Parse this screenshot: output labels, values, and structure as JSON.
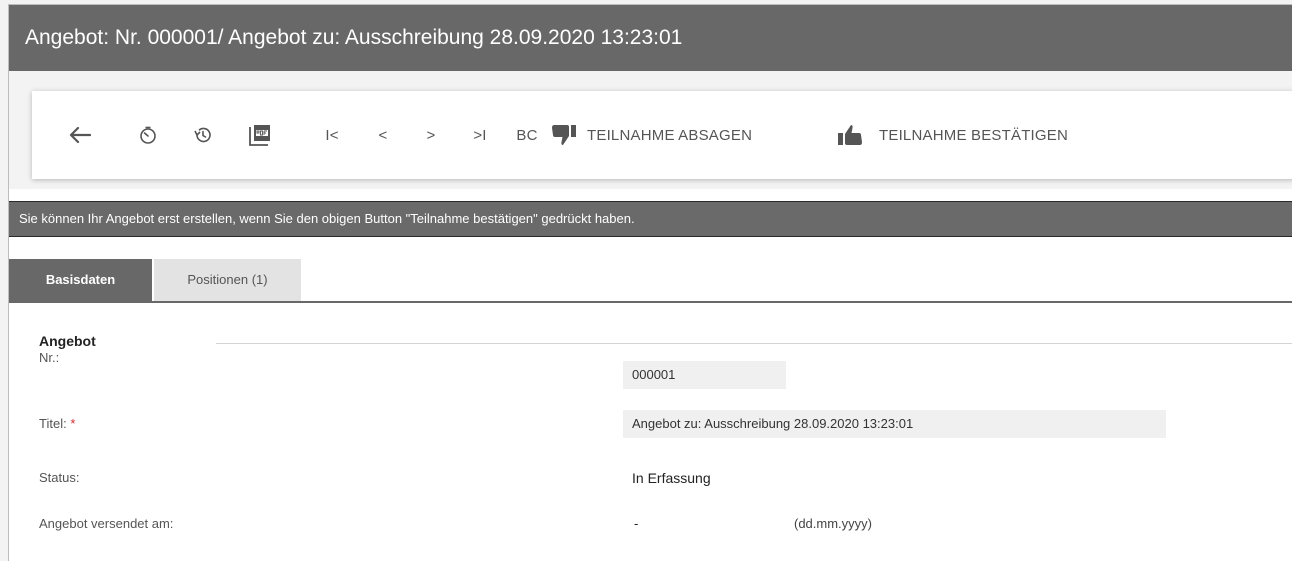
{
  "window": {
    "title": "Angebot: Nr. 000001/ Angebot zu: Ausschreibung 28.09.2020 13:23:01"
  },
  "toolbar": {
    "back_icon": "arrow-left-icon",
    "timer_icon": "stopwatch-icon",
    "history_icon": "history-icon",
    "pdf_icon": "pdf-icon",
    "first_label": "I<",
    "prev_label": "<",
    "next_label": ">",
    "last_label": ">I",
    "bc_label": "BC",
    "decline_label": "TEILNAHME ABSAGEN",
    "decline_icon": "thumbs-down-icon",
    "confirm_label": "TEILNAHME BESTÄTIGEN",
    "confirm_icon": "thumbs-up-icon"
  },
  "notice": {
    "text": "Sie können Ihr Angebot erst erstellen, wenn Sie den obigen Button \"Teilnahme bestätigen\" gedrückt haben."
  },
  "tabs": [
    {
      "label": "Basisdaten",
      "active": true
    },
    {
      "label": "Positionen (1)",
      "active": false
    }
  ],
  "form": {
    "section_title": "Angebot",
    "fields": {
      "nr": {
        "label": "Nr.:",
        "value": "000001"
      },
      "titel": {
        "label": "Titel:",
        "required_mark": "*",
        "value": "Angebot zu: Ausschreibung 28.09.2020 13:23:01"
      },
      "status": {
        "label": "Status:",
        "value": "In Erfassung"
      },
      "versendet": {
        "label": "Angebot versendet am:",
        "value": "-",
        "format_hint": "(dd.mm.yyyy)"
      }
    }
  },
  "colors": {
    "header_bg": "#676867",
    "notice_bg": "#696a69",
    "required": "#d32f2f"
  }
}
